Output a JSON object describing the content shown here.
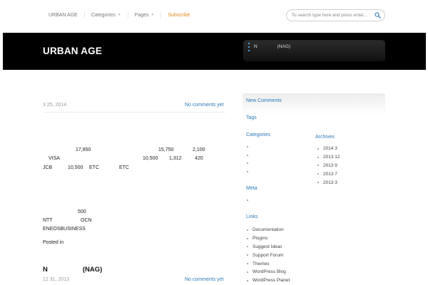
{
  "nav": {
    "items": [
      {
        "label": "URBAN AGE",
        "caret": false
      },
      {
        "label": "Categories",
        "caret": true
      },
      {
        "label": "Pages",
        "caret": true
      }
    ],
    "subscribe": "Subscribe",
    "search_placeholder": "To search type here and press enter..."
  },
  "header": {
    "site_title": "URBAN AGE",
    "box_items": [
      "",
      "N",
      ""
    ],
    "box_item_suffix": "(NAG)"
  },
  "post1": {
    "date": "3  25, 2014",
    "comments": "No comments yet",
    "table": {
      "r1": [
        "17,850",
        "15,750",
        "2,100"
      ],
      "r2": [
        "VISA",
        "10,500",
        "1,312",
        "420"
      ],
      "r3": [
        "JCB",
        "10,500",
        "ETC",
        "ETC"
      ]
    },
    "body": {
      "n500": "500",
      "ntt": "NTT",
      "ocn": "OCN",
      "eneos": "ENEOSBUSINESS",
      "posted": "Posted in"
    }
  },
  "post2": {
    "title_a": "N",
    "title_b": "(NAG)",
    "date": "12  31, 2013",
    "comments": "No comments yet"
  },
  "sidebar": {
    "new_comments": "New Comments",
    "tags": "Tags",
    "categories": "Categories",
    "categories_items": [
      "",
      "",
      "",
      ""
    ],
    "archives": "Archives",
    "archives_items": [
      "2014 3",
      "2013 12",
      "2013 9",
      "2013 7",
      "2013 3"
    ],
    "meta": "Meta",
    "meta_items": [
      ""
    ],
    "links": "Links",
    "links_items": [
      "Documentation",
      "Plugins",
      "Suggest Ideas",
      "Support Forum",
      "Themes",
      "WordPress Blog",
      "WordPress Planet"
    ]
  },
  "colors": {
    "accent": "#2a7ab8",
    "subscribe": "#e08a1e",
    "header_bg": "#000000"
  }
}
